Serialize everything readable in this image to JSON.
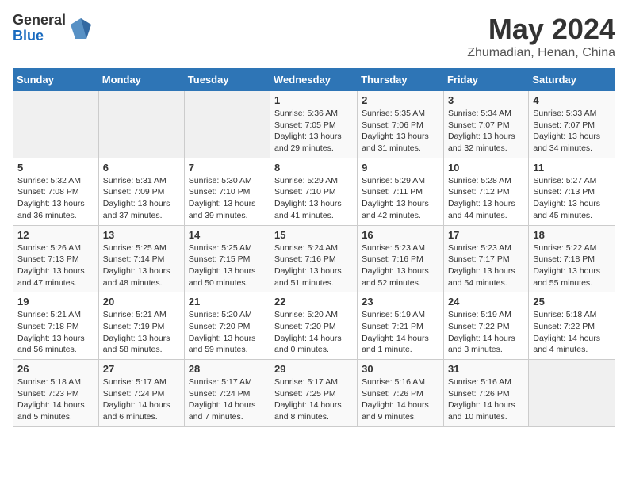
{
  "header": {
    "logo_general": "General",
    "logo_blue": "Blue",
    "main_title": "May 2024",
    "subtitle": "Zhumadian, Henan, China"
  },
  "days_of_week": [
    "Sunday",
    "Monday",
    "Tuesday",
    "Wednesday",
    "Thursday",
    "Friday",
    "Saturday"
  ],
  "weeks": [
    {
      "days": [
        {
          "number": "",
          "info": "",
          "empty": true
        },
        {
          "number": "",
          "info": "",
          "empty": true
        },
        {
          "number": "",
          "info": "",
          "empty": true
        },
        {
          "number": "1",
          "info": "Sunrise: 5:36 AM\nSunset: 7:05 PM\nDaylight: 13 hours and 29 minutes.",
          "empty": false
        },
        {
          "number": "2",
          "info": "Sunrise: 5:35 AM\nSunset: 7:06 PM\nDaylight: 13 hours and 31 minutes.",
          "empty": false
        },
        {
          "number": "3",
          "info": "Sunrise: 5:34 AM\nSunset: 7:07 PM\nDaylight: 13 hours and 32 minutes.",
          "empty": false
        },
        {
          "number": "4",
          "info": "Sunrise: 5:33 AM\nSunset: 7:07 PM\nDaylight: 13 hours and 34 minutes.",
          "empty": false
        }
      ]
    },
    {
      "days": [
        {
          "number": "5",
          "info": "Sunrise: 5:32 AM\nSunset: 7:08 PM\nDaylight: 13 hours and 36 minutes.",
          "empty": false
        },
        {
          "number": "6",
          "info": "Sunrise: 5:31 AM\nSunset: 7:09 PM\nDaylight: 13 hours and 37 minutes.",
          "empty": false
        },
        {
          "number": "7",
          "info": "Sunrise: 5:30 AM\nSunset: 7:10 PM\nDaylight: 13 hours and 39 minutes.",
          "empty": false
        },
        {
          "number": "8",
          "info": "Sunrise: 5:29 AM\nSunset: 7:10 PM\nDaylight: 13 hours and 41 minutes.",
          "empty": false
        },
        {
          "number": "9",
          "info": "Sunrise: 5:29 AM\nSunset: 7:11 PM\nDaylight: 13 hours and 42 minutes.",
          "empty": false
        },
        {
          "number": "10",
          "info": "Sunrise: 5:28 AM\nSunset: 7:12 PM\nDaylight: 13 hours and 44 minutes.",
          "empty": false
        },
        {
          "number": "11",
          "info": "Sunrise: 5:27 AM\nSunset: 7:13 PM\nDaylight: 13 hours and 45 minutes.",
          "empty": false
        }
      ]
    },
    {
      "days": [
        {
          "number": "12",
          "info": "Sunrise: 5:26 AM\nSunset: 7:13 PM\nDaylight: 13 hours and 47 minutes.",
          "empty": false
        },
        {
          "number": "13",
          "info": "Sunrise: 5:25 AM\nSunset: 7:14 PM\nDaylight: 13 hours and 48 minutes.",
          "empty": false
        },
        {
          "number": "14",
          "info": "Sunrise: 5:25 AM\nSunset: 7:15 PM\nDaylight: 13 hours and 50 minutes.",
          "empty": false
        },
        {
          "number": "15",
          "info": "Sunrise: 5:24 AM\nSunset: 7:16 PM\nDaylight: 13 hours and 51 minutes.",
          "empty": false
        },
        {
          "number": "16",
          "info": "Sunrise: 5:23 AM\nSunset: 7:16 PM\nDaylight: 13 hours and 52 minutes.",
          "empty": false
        },
        {
          "number": "17",
          "info": "Sunrise: 5:23 AM\nSunset: 7:17 PM\nDaylight: 13 hours and 54 minutes.",
          "empty": false
        },
        {
          "number": "18",
          "info": "Sunrise: 5:22 AM\nSunset: 7:18 PM\nDaylight: 13 hours and 55 minutes.",
          "empty": false
        }
      ]
    },
    {
      "days": [
        {
          "number": "19",
          "info": "Sunrise: 5:21 AM\nSunset: 7:18 PM\nDaylight: 13 hours and 56 minutes.",
          "empty": false
        },
        {
          "number": "20",
          "info": "Sunrise: 5:21 AM\nSunset: 7:19 PM\nDaylight: 13 hours and 58 minutes.",
          "empty": false
        },
        {
          "number": "21",
          "info": "Sunrise: 5:20 AM\nSunset: 7:20 PM\nDaylight: 13 hours and 59 minutes.",
          "empty": false
        },
        {
          "number": "22",
          "info": "Sunrise: 5:20 AM\nSunset: 7:20 PM\nDaylight: 14 hours and 0 minutes.",
          "empty": false
        },
        {
          "number": "23",
          "info": "Sunrise: 5:19 AM\nSunset: 7:21 PM\nDaylight: 14 hours and 1 minute.",
          "empty": false
        },
        {
          "number": "24",
          "info": "Sunrise: 5:19 AM\nSunset: 7:22 PM\nDaylight: 14 hours and 3 minutes.",
          "empty": false
        },
        {
          "number": "25",
          "info": "Sunrise: 5:18 AM\nSunset: 7:22 PM\nDaylight: 14 hours and 4 minutes.",
          "empty": false
        }
      ]
    },
    {
      "days": [
        {
          "number": "26",
          "info": "Sunrise: 5:18 AM\nSunset: 7:23 PM\nDaylight: 14 hours and 5 minutes.",
          "empty": false
        },
        {
          "number": "27",
          "info": "Sunrise: 5:17 AM\nSunset: 7:24 PM\nDaylight: 14 hours and 6 minutes.",
          "empty": false
        },
        {
          "number": "28",
          "info": "Sunrise: 5:17 AM\nSunset: 7:24 PM\nDaylight: 14 hours and 7 minutes.",
          "empty": false
        },
        {
          "number": "29",
          "info": "Sunrise: 5:17 AM\nSunset: 7:25 PM\nDaylight: 14 hours and 8 minutes.",
          "empty": false
        },
        {
          "number": "30",
          "info": "Sunrise: 5:16 AM\nSunset: 7:26 PM\nDaylight: 14 hours and 9 minutes.",
          "empty": false
        },
        {
          "number": "31",
          "info": "Sunrise: 5:16 AM\nSunset: 7:26 PM\nDaylight: 14 hours and 10 minutes.",
          "empty": false
        },
        {
          "number": "",
          "info": "",
          "empty": true
        }
      ]
    }
  ]
}
